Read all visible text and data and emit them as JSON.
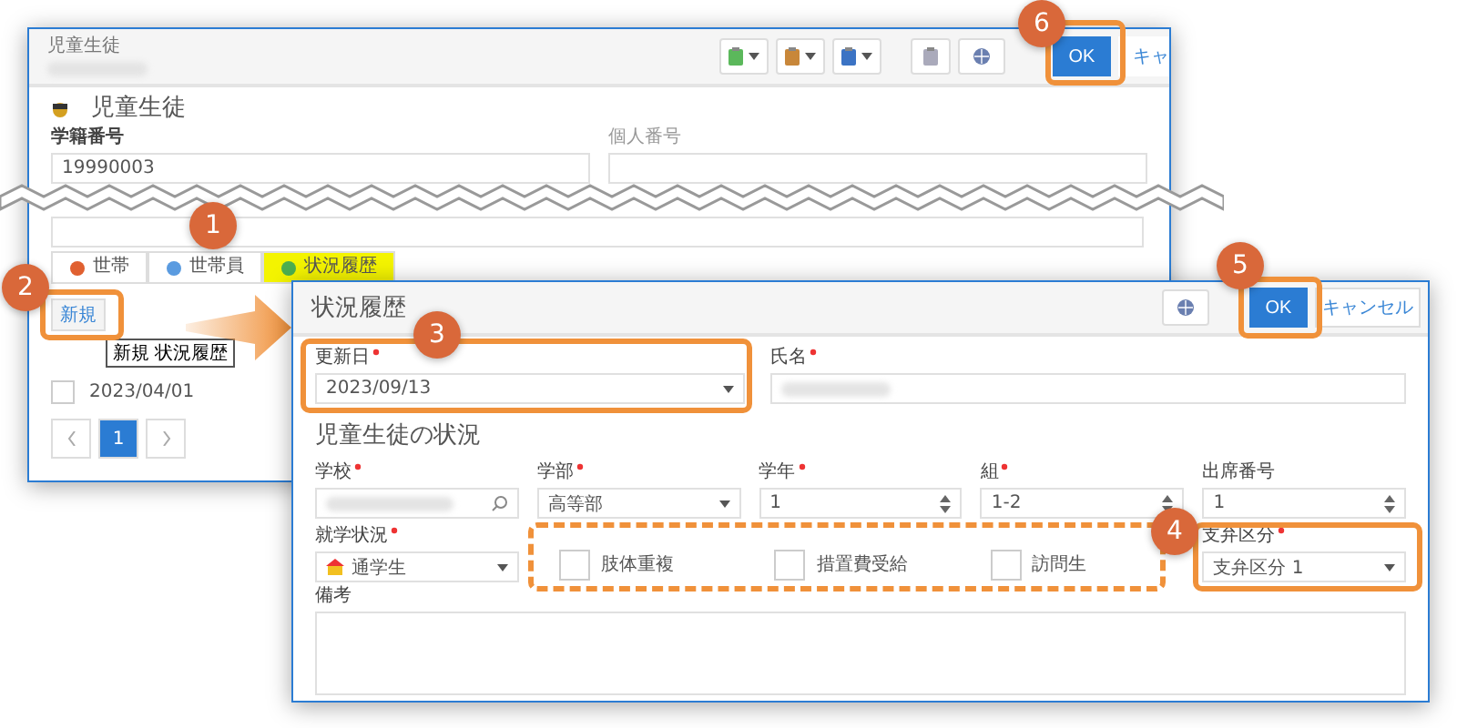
{
  "background_window": {
    "title": "児童生徒",
    "ok": "OK",
    "cancel": "キャ",
    "heading": "児童生徒",
    "fields": [
      {
        "label": "学籍番号",
        "value": "19990003"
      },
      {
        "label": "個人番号"
      }
    ],
    "tabs": [
      {
        "label": "世帯",
        "selected": false
      },
      {
        "label": "世帯員",
        "selected": false
      },
      {
        "label": "状況履歴",
        "selected": true
      }
    ],
    "new_button": "新規",
    "tooltip": "新規 状況履歴",
    "rows": [
      {
        "date": "2023/04/01",
        "checked": false
      }
    ],
    "pager": [
      {
        "label": "1",
        "selected": true
      }
    ]
  },
  "dialog": {
    "title": "状況履歴",
    "ok": "OK",
    "cancel": "キャンセル",
    "update_date": {
      "label": "更新日",
      "required": true,
      "value": "2023/09/13"
    },
    "name": {
      "label": "氏名",
      "required": true
    },
    "section_title": "児童生徒の状況",
    "row_1": [
      {
        "kind": "search",
        "label": "学校",
        "required": true
      },
      {
        "kind": "select",
        "label": "学部",
        "required": true,
        "value": "高等部"
      },
      {
        "kind": "spinner",
        "label": "学年",
        "required": true,
        "value": "1"
      },
      {
        "kind": "spinner",
        "label": "組",
        "required": true,
        "value": "1-2"
      },
      {
        "kind": "spinner",
        "label": "出席番号",
        "required": false,
        "value": "1"
      }
    ],
    "status": {
      "label": "就学状況",
      "required": true,
      "value": "通学生"
    },
    "checkboxes": [
      {
        "label": "肢体重複",
        "checked": false
      },
      {
        "label": "措置費受給",
        "checked": false
      },
      {
        "label": "訪問生",
        "checked": false
      }
    ],
    "support": {
      "label": "支弁区分",
      "required": true,
      "value": "支弁区分 1"
    },
    "notes": {
      "label": "備考"
    }
  },
  "callouts": [
    "1",
    "2",
    "3",
    "4",
    "5",
    "6"
  ]
}
